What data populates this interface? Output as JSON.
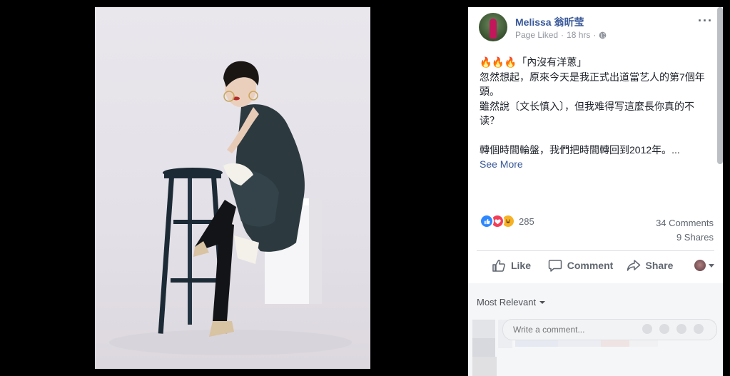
{
  "post": {
    "author": "Melissa 翁昕莹",
    "meta_liked": "Page Liked",
    "meta_dot": "·",
    "meta_time": "18 hrs",
    "meta_dot2": "·",
    "more_icon": "···",
    "lines": [
      "🔥🔥🔥「內沒有洋蔥」",
      "忽然想起，原來今天是我正式出道當艺人的第7個年頭。",
      "雖然說〔文长慎入〕，但我难得写這麼長你真的不读？",
      "",
      "轉個時間輪盤，我們把時間轉回到2012年。..."
    ],
    "see_more": "See More"
  },
  "reactions": {
    "icons": [
      "like-reaction-icon",
      "love-reaction-icon",
      "haha-reaction-icon"
    ],
    "count": "285"
  },
  "stats": {
    "comments": "34 Comments",
    "shares": "9 Shares"
  },
  "actions": {
    "like": "Like",
    "comment": "Comment",
    "share": "Share"
  },
  "comments": {
    "sort_label": "Most Relevant",
    "input_placeholder": "Write a comment..."
  },
  "colors": {
    "link": "#385898",
    "secondary_text": "#606770",
    "like_blue": "#2d88ff",
    "love_red": "#f33e58",
    "haha_yellow": "#f7b125"
  }
}
